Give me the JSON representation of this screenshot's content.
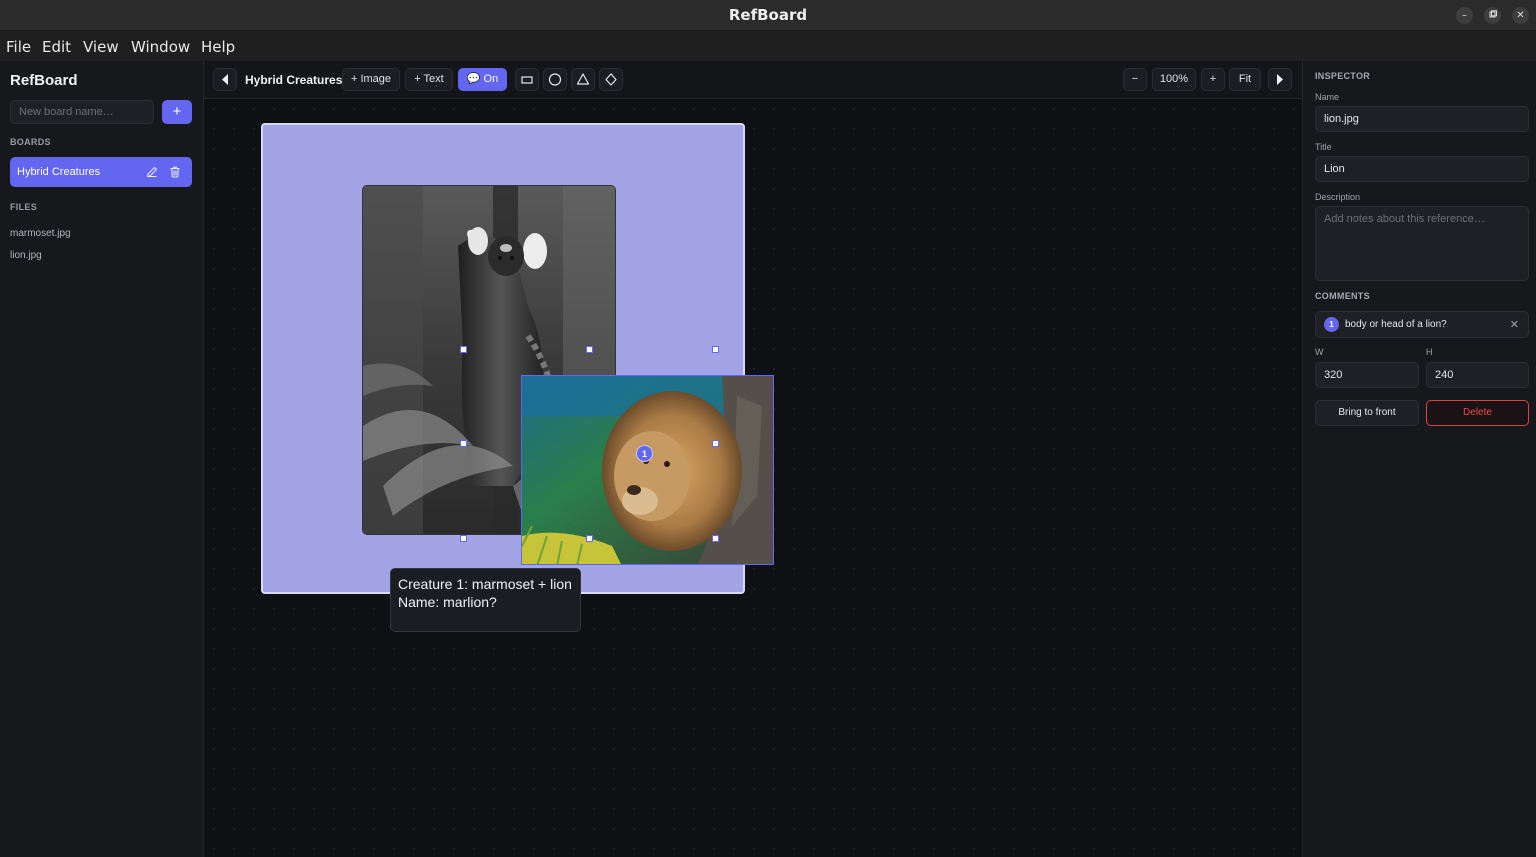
{
  "window": {
    "title": "RefBoard"
  },
  "menubar": {
    "items": [
      "File",
      "Edit",
      "View",
      "Window",
      "Help"
    ]
  },
  "sidebar": {
    "brand": "RefBoard",
    "new_board_placeholder": "New board name…",
    "add_label": "+",
    "boards_label": "BOARDS",
    "boards": [
      {
        "label": "Hybrid Creatures"
      }
    ],
    "files_label": "FILES",
    "files": [
      "marmoset.jpg",
      "lion.jpg"
    ]
  },
  "toolbar": {
    "board_title": "Hybrid Creatures",
    "add_image": "+ Image",
    "add_text": "+ Text",
    "comments_toggle": "On",
    "zoom_out": "−",
    "zoom_level": "100%",
    "zoom_in": "+",
    "fit": "Fit"
  },
  "canvas": {
    "frame_color": "#a3a4e6",
    "comment_pin": "1",
    "note_lines": [
      "Creature 1: marmoset + lion",
      "Name: marlion?"
    ]
  },
  "inspector": {
    "title": "INSPECTOR",
    "name_label": "Name",
    "name_value": "lion.jpg",
    "title_label": "Title",
    "title_value": "Lion",
    "description_label": "Description",
    "description_placeholder": "Add notes about this reference…",
    "comments_label": "COMMENTS",
    "comments": [
      {
        "num": "1",
        "text": "body or head of a lion?"
      }
    ],
    "w_label": "W",
    "w_value": "320",
    "h_label": "H",
    "h_value": "240",
    "bring_to_front": "Bring to front",
    "delete": "Delete"
  },
  "colors": {
    "accent": "#6366f1",
    "danger": "#ef4b43"
  }
}
